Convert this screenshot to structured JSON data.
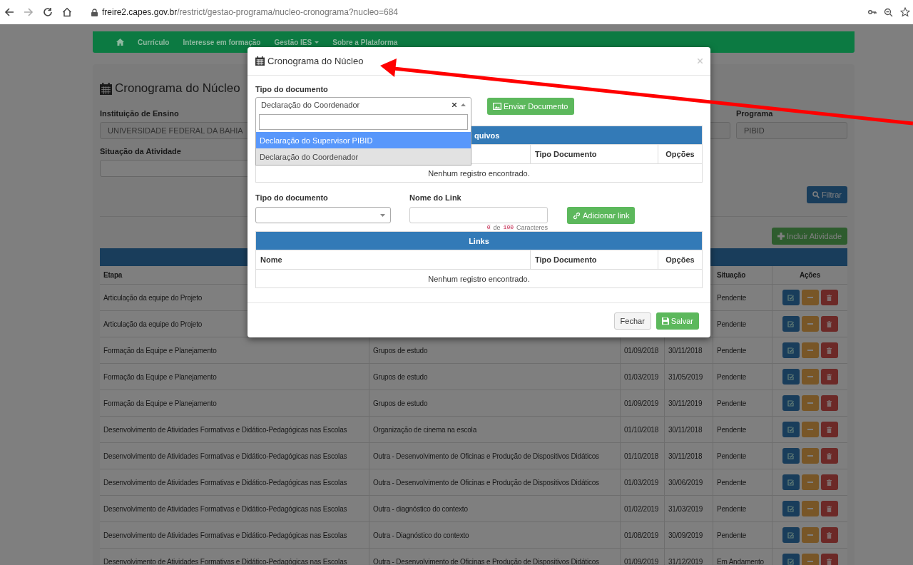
{
  "browser": {
    "url_host": "freire2.capes.gov.br",
    "url_path": "/restrict/gestao-programa/nucleo-cronograma?nucleo=684"
  },
  "nav": {
    "items": [
      {
        "label": "Currículo",
        "dropdown": false
      },
      {
        "label": "Interesse em formação",
        "dropdown": false
      },
      {
        "label": "Gestão IES",
        "dropdown": true
      },
      {
        "label": "Sobre a Plataforma",
        "dropdown": false
      }
    ]
  },
  "page": {
    "title": "Cronograma do Núcleo",
    "institution": {
      "label": "Instituição de Ensino",
      "value": "UNIVERSIDADE FEDERAL DA BAHIA"
    },
    "program": {
      "label": "Programa",
      "value": "PIBID"
    },
    "status_filter": {
      "label": "Situação da Atividade"
    },
    "filter_button": "Filtrar",
    "add_button": "Incluir Atividade",
    "table": {
      "headers": {
        "etapa": "Etapa",
        "situacao": "Situação",
        "acoes": "Ações"
      },
      "rows": [
        {
          "etapa": "Articulação da equipe do Projeto",
          "situacao": "Pendente"
        },
        {
          "etapa": "Articulação da equipe do Projeto",
          "situacao": "Pendente"
        },
        {
          "etapa": "Formação da Equipe e Planejamento",
          "atividade": "Grupos de estudo",
          "inicio": "01/09/2018",
          "fim": "30/11/2018",
          "situacao": "Pendente"
        },
        {
          "etapa": "Formação da Equipe e Planejamento",
          "atividade": "Grupos de estudo",
          "inicio": "01/03/2019",
          "fim": "31/05/2019",
          "situacao": "Pendente"
        },
        {
          "etapa": "Formação da Equipe e Planejamento",
          "atividade": "Grupos de estudo",
          "inicio": "01/09/2019",
          "fim": "30/11/2019",
          "situacao": "Pendente"
        },
        {
          "etapa": "Desenvolvimento de Atividades Formativas e Didático-Pedagógicas nas Escolas",
          "atividade": "Organização de cinema na escola",
          "inicio": "01/10/2018",
          "fim": "30/11/2018",
          "situacao": "Pendente"
        },
        {
          "etapa": "Desenvolvimento de Atividades Formativas e Didático-Pedagógicas nas Escolas",
          "atividade": "Outra - Desenvolvimento de Oficinas e Produção de Dispositivos Didáticos",
          "inicio": "01/10/2018",
          "fim": "30/11/2018",
          "situacao": "Pendente"
        },
        {
          "etapa": "Desenvolvimento de Atividades Formativas e Didático-Pedagógicas nas Escolas",
          "atividade": "Outra - Desenvolvimento de Oficinas e Produção de Dispositivos Didáticos",
          "inicio": "01/03/2019",
          "fim": "30/06/2019",
          "situacao": "Pendente"
        },
        {
          "etapa": "Desenvolvimento de Atividades Formativas e Didático-Pedagógicas nas Escolas",
          "atividade": "Outra - diagnóstico do contexto",
          "inicio": "01/02/2019",
          "fim": "31/03/2019",
          "situacao": "Pendente"
        },
        {
          "etapa": "Desenvolvimento de Atividades Formativas e Didático-Pedagógicas nas Escolas",
          "atividade": "Outra - Diagnóstico do contexto",
          "inicio": "01/08/2019",
          "fim": "30/09/2019",
          "situacao": "Pendente"
        },
        {
          "etapa": "Desenvolvimento de Atividades Formativas e Didático-Pedagógicas nas Escolas",
          "atividade": "Outra - Desenvolvimento de Oficinas e Produção de Dispositivos Didáticos",
          "inicio": "01/09/2019",
          "fim": "31/12/2019",
          "situacao": "Em Andamento"
        }
      ]
    }
  },
  "modal": {
    "title": "Cronograma do Núcleo",
    "doc_label": "Tipo do documento",
    "doc_value": "Declaração do Coordenador",
    "send_button": "Enviar Documento",
    "dropdown": {
      "open": true,
      "options": [
        {
          "label": "Declaração do Supervisor PIBID",
          "selected": true
        },
        {
          "label": "Declaração do Coordenador",
          "selected": false
        }
      ]
    },
    "files_table": {
      "title": "quivos",
      "columns": [
        "Tipo Documento",
        "Opções"
      ],
      "empty": "Nenhum registro encontrado."
    },
    "link_doc_label": "Tipo do documento",
    "link_name_label": "Nome do Link",
    "add_link_button": "Adicionar link",
    "counter": {
      "count": "0",
      "sep": "de",
      "max": "100",
      "unit": "Caracteres"
    },
    "links_table": {
      "title": "Links",
      "columns": [
        "Nome",
        "Tipo Documento",
        "Opções"
      ],
      "empty": "Nenhum registro encontrado."
    },
    "close_button": "Fechar",
    "save_button": "Salvar"
  },
  "annotation_arrow": true
}
